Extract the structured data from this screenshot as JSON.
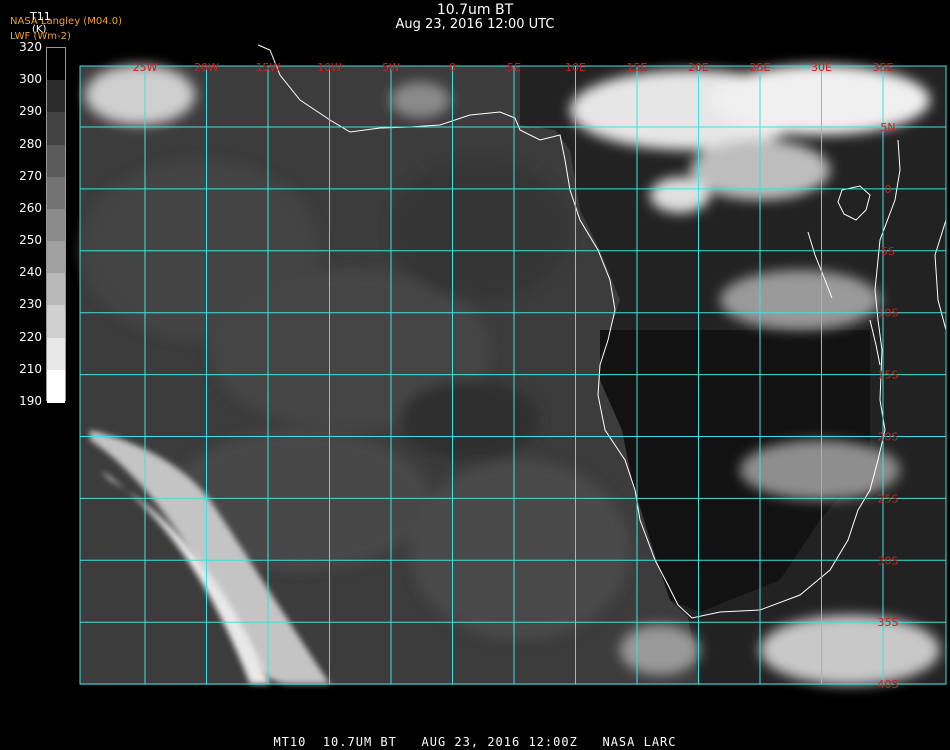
{
  "header": {
    "title": "10.7um BT",
    "datetime": "Aug 23, 2016 12:00 UTC"
  },
  "credits": {
    "source": "NASA Langley (M04.0)",
    "field": "LWF (Wm-2)"
  },
  "legend": {
    "variable": "T11",
    "unit": "(K)",
    "ticks": [
      "320",
      "300",
      "290",
      "280",
      "270",
      "260",
      "250",
      "240",
      "230",
      "220",
      "210",
      "190"
    ]
  },
  "map": {
    "lon_labels": [
      "25W",
      "20W",
      "15W",
      "10W",
      "5W",
      "0",
      "5E",
      "10E",
      "15E",
      "20E",
      "25E",
      "30E",
      "35E"
    ],
    "lat_labels": [
      "5N",
      "0",
      "5S",
      "10S",
      "15S",
      "20S",
      "25S",
      "30S",
      "35S",
      "40S"
    ],
    "grid_color": "#40e0e0",
    "label_color": "#cc2020",
    "coast_color": "#ffffff"
  },
  "footer": {
    "text": "MT10  10.7UM BT   AUG 23, 2016 12:00Z   NASA LARC"
  }
}
